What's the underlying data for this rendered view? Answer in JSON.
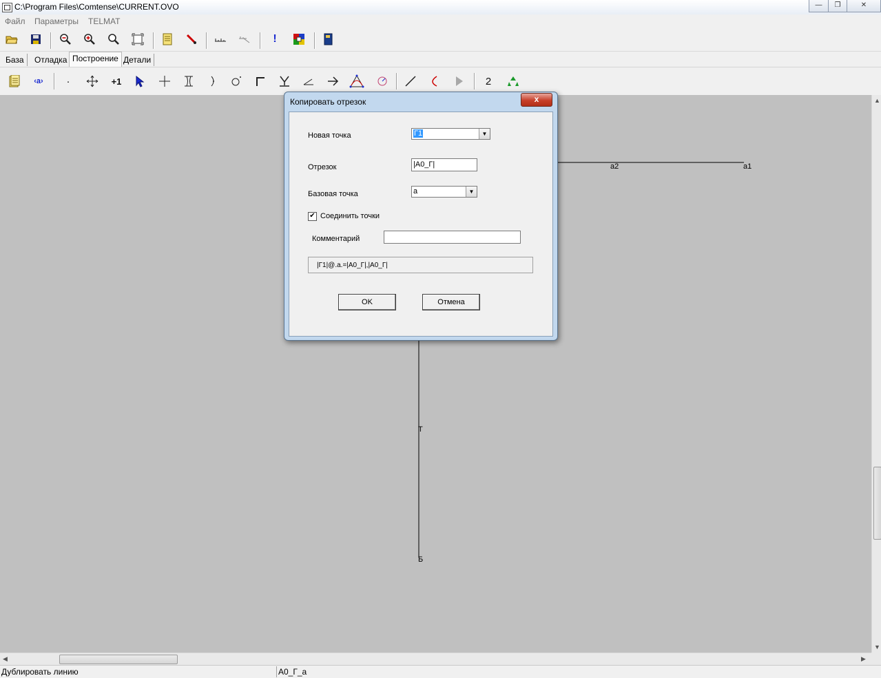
{
  "window": {
    "title": "C:\\Program Files\\Comtense\\CURRENT.OVO",
    "minimize": "—",
    "maximize": "❐",
    "close": "✕"
  },
  "menu": [
    "Файл",
    "Параметры",
    "TELMAT"
  ],
  "tabs": [
    "База",
    "Отладка",
    "Построение",
    "Детали"
  ],
  "toolbar2": {
    "counter": "2"
  },
  "canvas": {
    "labels": {
      "a2": "a2",
      "a1": "a1",
      "t": "T",
      "b": "Б"
    }
  },
  "dialog": {
    "title": "Копировать отрезок",
    "close": "x",
    "new_point_label": "Новая точка",
    "new_point_value": "Г1",
    "segment_label": "Отрезок",
    "segment_value": "|A0_Г|",
    "base_point_label": "Базовая точка",
    "base_point_value": "a",
    "connect_label": "Соединить точки",
    "connect_checked": true,
    "comment_label": "Комментарий",
    "comment_value": "",
    "formula": "|Г1|@.a.=|A0_Г|,|A0_Г|",
    "ok": "OK",
    "cancel": "Отмена"
  },
  "status": {
    "left": "Дублировать линию",
    "right": "A0_Г_a"
  }
}
